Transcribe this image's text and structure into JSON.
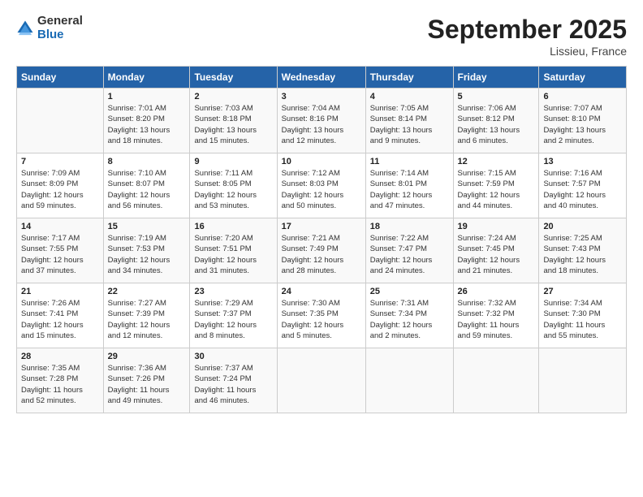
{
  "logo": {
    "general": "General",
    "blue": "Blue"
  },
  "title": "September 2025",
  "location": "Lissieu, France",
  "days_header": [
    "Sunday",
    "Monday",
    "Tuesday",
    "Wednesday",
    "Thursday",
    "Friday",
    "Saturday"
  ],
  "weeks": [
    [
      {
        "day": "",
        "info": ""
      },
      {
        "day": "1",
        "info": "Sunrise: 7:01 AM\nSunset: 8:20 PM\nDaylight: 13 hours\nand 18 minutes."
      },
      {
        "day": "2",
        "info": "Sunrise: 7:03 AM\nSunset: 8:18 PM\nDaylight: 13 hours\nand 15 minutes."
      },
      {
        "day": "3",
        "info": "Sunrise: 7:04 AM\nSunset: 8:16 PM\nDaylight: 13 hours\nand 12 minutes."
      },
      {
        "day": "4",
        "info": "Sunrise: 7:05 AM\nSunset: 8:14 PM\nDaylight: 13 hours\nand 9 minutes."
      },
      {
        "day": "5",
        "info": "Sunrise: 7:06 AM\nSunset: 8:12 PM\nDaylight: 13 hours\nand 6 minutes."
      },
      {
        "day": "6",
        "info": "Sunrise: 7:07 AM\nSunset: 8:10 PM\nDaylight: 13 hours\nand 2 minutes."
      }
    ],
    [
      {
        "day": "7",
        "info": "Sunrise: 7:09 AM\nSunset: 8:09 PM\nDaylight: 12 hours\nand 59 minutes."
      },
      {
        "day": "8",
        "info": "Sunrise: 7:10 AM\nSunset: 8:07 PM\nDaylight: 12 hours\nand 56 minutes."
      },
      {
        "day": "9",
        "info": "Sunrise: 7:11 AM\nSunset: 8:05 PM\nDaylight: 12 hours\nand 53 minutes."
      },
      {
        "day": "10",
        "info": "Sunrise: 7:12 AM\nSunset: 8:03 PM\nDaylight: 12 hours\nand 50 minutes."
      },
      {
        "day": "11",
        "info": "Sunrise: 7:14 AM\nSunset: 8:01 PM\nDaylight: 12 hours\nand 47 minutes."
      },
      {
        "day": "12",
        "info": "Sunrise: 7:15 AM\nSunset: 7:59 PM\nDaylight: 12 hours\nand 44 minutes."
      },
      {
        "day": "13",
        "info": "Sunrise: 7:16 AM\nSunset: 7:57 PM\nDaylight: 12 hours\nand 40 minutes."
      }
    ],
    [
      {
        "day": "14",
        "info": "Sunrise: 7:17 AM\nSunset: 7:55 PM\nDaylight: 12 hours\nand 37 minutes."
      },
      {
        "day": "15",
        "info": "Sunrise: 7:19 AM\nSunset: 7:53 PM\nDaylight: 12 hours\nand 34 minutes."
      },
      {
        "day": "16",
        "info": "Sunrise: 7:20 AM\nSunset: 7:51 PM\nDaylight: 12 hours\nand 31 minutes."
      },
      {
        "day": "17",
        "info": "Sunrise: 7:21 AM\nSunset: 7:49 PM\nDaylight: 12 hours\nand 28 minutes."
      },
      {
        "day": "18",
        "info": "Sunrise: 7:22 AM\nSunset: 7:47 PM\nDaylight: 12 hours\nand 24 minutes."
      },
      {
        "day": "19",
        "info": "Sunrise: 7:24 AM\nSunset: 7:45 PM\nDaylight: 12 hours\nand 21 minutes."
      },
      {
        "day": "20",
        "info": "Sunrise: 7:25 AM\nSunset: 7:43 PM\nDaylight: 12 hours\nand 18 minutes."
      }
    ],
    [
      {
        "day": "21",
        "info": "Sunrise: 7:26 AM\nSunset: 7:41 PM\nDaylight: 12 hours\nand 15 minutes."
      },
      {
        "day": "22",
        "info": "Sunrise: 7:27 AM\nSunset: 7:39 PM\nDaylight: 12 hours\nand 12 minutes."
      },
      {
        "day": "23",
        "info": "Sunrise: 7:29 AM\nSunset: 7:37 PM\nDaylight: 12 hours\nand 8 minutes."
      },
      {
        "day": "24",
        "info": "Sunrise: 7:30 AM\nSunset: 7:35 PM\nDaylight: 12 hours\nand 5 minutes."
      },
      {
        "day": "25",
        "info": "Sunrise: 7:31 AM\nSunset: 7:34 PM\nDaylight: 12 hours\nand 2 minutes."
      },
      {
        "day": "26",
        "info": "Sunrise: 7:32 AM\nSunset: 7:32 PM\nDaylight: 11 hours\nand 59 minutes."
      },
      {
        "day": "27",
        "info": "Sunrise: 7:34 AM\nSunset: 7:30 PM\nDaylight: 11 hours\nand 55 minutes."
      }
    ],
    [
      {
        "day": "28",
        "info": "Sunrise: 7:35 AM\nSunset: 7:28 PM\nDaylight: 11 hours\nand 52 minutes."
      },
      {
        "day": "29",
        "info": "Sunrise: 7:36 AM\nSunset: 7:26 PM\nDaylight: 11 hours\nand 49 minutes."
      },
      {
        "day": "30",
        "info": "Sunrise: 7:37 AM\nSunset: 7:24 PM\nDaylight: 11 hours\nand 46 minutes."
      },
      {
        "day": "",
        "info": ""
      },
      {
        "day": "",
        "info": ""
      },
      {
        "day": "",
        "info": ""
      },
      {
        "day": "",
        "info": ""
      }
    ]
  ]
}
